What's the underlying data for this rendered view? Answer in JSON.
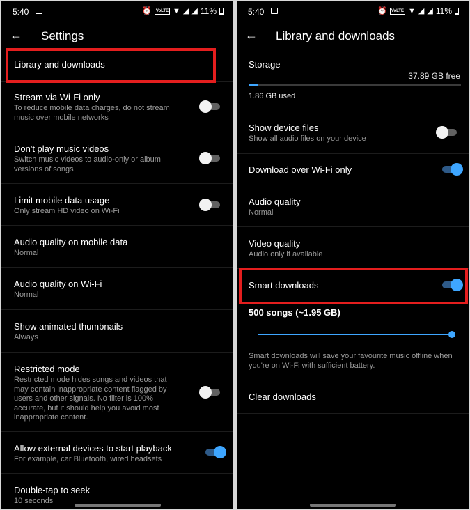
{
  "status": {
    "time": "5:40",
    "battery": "11%",
    "volte": "VoLTE"
  },
  "left": {
    "title": "Settings",
    "rows": [
      {
        "title": "Library and downloads"
      },
      {
        "title": "Stream via Wi-Fi only",
        "subtitle": "To reduce mobile data charges, do not stream music over mobile networks",
        "toggle": "off"
      },
      {
        "title": "Don't play music videos",
        "subtitle": "Switch music videos to audio-only or album versions of songs",
        "toggle": "off"
      },
      {
        "title": "Limit mobile data usage",
        "subtitle": "Only stream HD video on Wi-Fi",
        "toggle": "off"
      },
      {
        "title": "Audio quality on mobile data",
        "subtitle": "Normal"
      },
      {
        "title": "Audio quality on Wi-Fi",
        "subtitle": "Normal"
      },
      {
        "title": "Show animated thumbnails",
        "subtitle": "Always"
      },
      {
        "title": "Restricted mode",
        "subtitle": "Restricted mode hides songs and videos that may contain inappropriate content flagged by users and other signals. No filter is 100% accurate, but it should help you avoid most inappropriate content.",
        "toggle": "off"
      },
      {
        "title": "Allow external devices to start playback",
        "subtitle": "For example, car Bluetooth, wired headsets",
        "toggle": "on"
      },
      {
        "title": "Double-tap to seek",
        "subtitle": "10 seconds"
      }
    ]
  },
  "right": {
    "title": "Library and downloads",
    "storage": {
      "label": "Storage",
      "free": "37.89 GB free",
      "used": "1.86 GB used",
      "used_fraction": 0.047
    },
    "rows": [
      {
        "title": "Show device files",
        "subtitle": "Show all audio files on your device",
        "toggle": "off"
      },
      {
        "title": "Download over Wi-Fi only",
        "toggle": "on"
      },
      {
        "title": "Audio quality",
        "subtitle": "Normal"
      },
      {
        "title": "Video quality",
        "subtitle": "Audio only if available"
      },
      {
        "title": "Smart downloads",
        "toggle": "on"
      }
    ],
    "smart": {
      "count": "500 songs (~1.95 GB)",
      "slider_fraction": 1.0,
      "desc": "Smart downloads will save your favourite music offline when you're on Wi-Fi with sufficient battery."
    },
    "clear": "Clear downloads"
  },
  "colors": {
    "highlight": "#e41e1e",
    "accent": "#3ea6ff"
  }
}
